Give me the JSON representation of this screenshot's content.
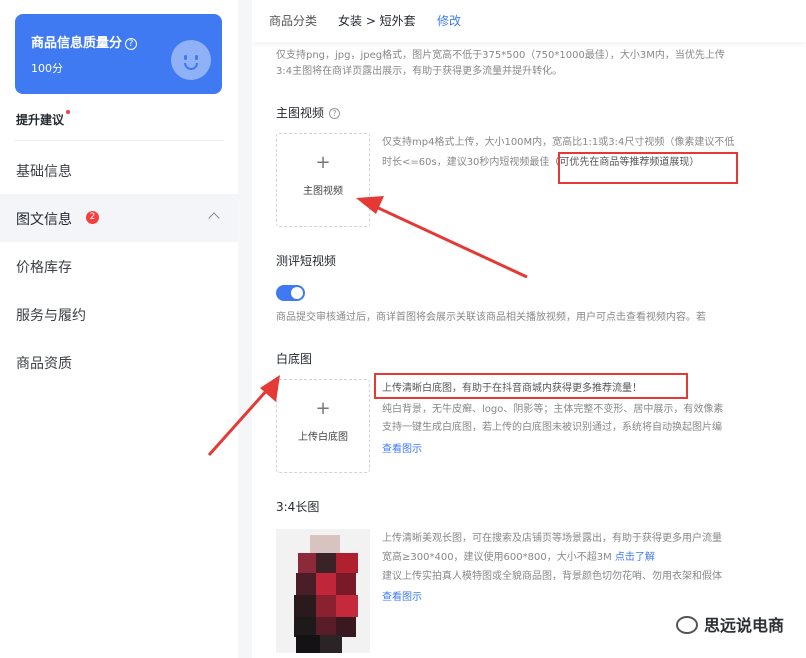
{
  "sidebar": {
    "score_title": "商品信息质量分",
    "score_help": "?",
    "score_value": "100分",
    "suggest_label": "提升建议",
    "nav": [
      {
        "label": "基础信息"
      },
      {
        "label": "图文信息",
        "badge": "2"
      },
      {
        "label": "价格库存"
      },
      {
        "label": "服务与履约"
      },
      {
        "label": "商品资质"
      }
    ]
  },
  "category": {
    "label": "商品分类",
    "value": "女装 > 短外套",
    "edit": "修改"
  },
  "image_hint": {
    "line1": "仅支持png，jpg，jpeg格式，图片宽高不低于375*500（750*1000最佳），大小3M内，当优先上传",
    "line2": "3:4主图将在商详页露出展示，有助于获得更多流量并提升转化。"
  },
  "main_video": {
    "title": "主图视频",
    "upload_label": "主图视频",
    "desc1": "仅支持mp4格式上传，大小100M内，宽高比1:1或3:4尺寸视频（像素建议不低",
    "desc2a": "时长<=60s，建议30秒内短视频最佳",
    "desc2b": "（可优先在商品等推荐频道展现）"
  },
  "review_video": {
    "title": "测评短视频",
    "desc": "商品提交审核通过后，商详首图将会展示关联该商品相关播放视频，用户可点击查看视频内容。若"
  },
  "white_bg": {
    "title": "白底图",
    "upload_label": "上传白底图",
    "desc1": "上传清晰白底图，有助于在抖音商城内获得更多推荐流量！",
    "desc2": "纯白背景，无牛皮癣、logo、阴影等；主体完整不变形、居中展示，有效像素",
    "desc3": "支持一键生成白底图，若上传的白底图未被识别通过，系统将自动换起图片编",
    "link": "查看图示"
  },
  "long_img": {
    "title": "3:4长图",
    "desc1": "上传清晰美观长图，可在搜索及店铺页等场景露出，有助于获得更多用户流量",
    "desc2a": "宽高≥300*400，建议使用600*800，大小不超3M",
    "desc2b": "点击了解",
    "desc3": "建议上传实拍真人模特图或全貌商品图，背景颜色切勿花哨、勿用衣架和假体",
    "link": "查看图示"
  },
  "watermark": "思远说电商",
  "colors": {
    "accent": "#3f7af2",
    "highlight": "#e53935",
    "badge": "#f53f3f"
  }
}
